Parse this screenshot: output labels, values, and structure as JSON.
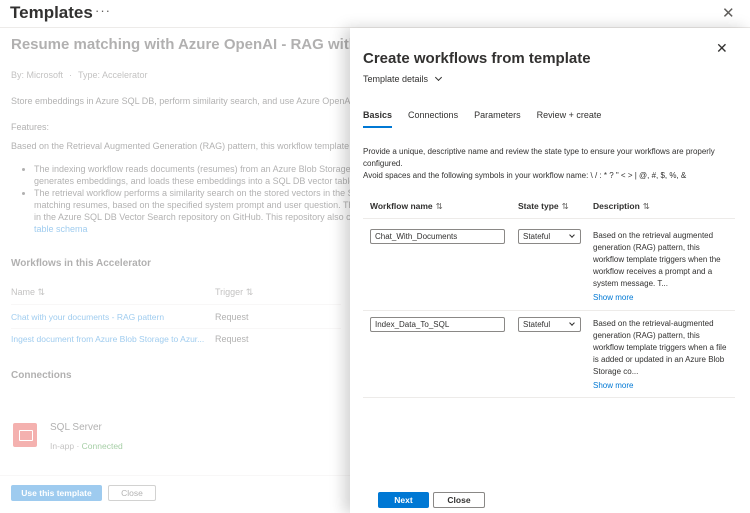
{
  "page": {
    "title": "Templates",
    "more_icon": "ellipsis-icon",
    "close_icon": "close-icon"
  },
  "background": {
    "template_title": "Resume matching with Azure OpenAI - RAG with",
    "publisher": "By: Microsoft",
    "type": "Type: Accelerator",
    "description": "Store embeddings in Azure SQL DB, perform similarity search, and use Azure OpenAI LL",
    "features_label": "Features:",
    "features_intro": "Based on the Retrieval Augmented Generation (RAG) pattern, this workflow template is",
    "bullets": [
      "The indexing workflow reads documents (resumes) from an Azure Blob Storage c",
      "generates embeddings, and loads these embeddings into a SQL DB vector table",
      "The retrieval workflow performs a similarity search on the stored vectors in the S",
      "matching resumes, based on the specified system prompt and user question. Th",
      "in the Azure SQL DB Vector Search repository on GitHub. This repository also co"
    ],
    "bullet_link": "table schema",
    "workflows_heading": "Workflows in this Accelerator",
    "table_headers": {
      "name": "Name",
      "trigger": "Trigger"
    },
    "workflows": [
      {
        "name": "Chat with your documents - RAG pattern",
        "trigger": "Request"
      },
      {
        "name": "Ingest document from Azure Blob Storage to Azur...",
        "trigger": "Request"
      }
    ],
    "connections_heading": "Connections",
    "connection": {
      "name": "SQL Server",
      "kind": "In-app",
      "status": "Connected"
    },
    "use_button": "Use this template",
    "close_button": "Close"
  },
  "panel": {
    "title": "Create workflows from template",
    "details_dropdown": "Template details",
    "tabs": [
      "Basics",
      "Connections",
      "Parameters",
      "Review + create"
    ],
    "active_tab": "Basics",
    "instructions_1": "Provide a unique, descriptive name and review the state type to ensure your workflows are properly configured.",
    "instructions_2": "Avoid spaces and the following symbols in your workflow name: \\ / : * ? \" < > | @, #, $, %, &",
    "columns": {
      "workflow_name": "Workflow name",
      "state_type": "State type",
      "description": "Description",
      "sort_icon": "⇅"
    },
    "rows": [
      {
        "workflow_name": "Chat_With_Documents",
        "state_type": "Stateful",
        "description": "Based on the retrieval augmented generation (RAG) pattern, this workflow template triggers when the workflow receives a prompt and a system message. T...",
        "show_more": "Show more"
      },
      {
        "workflow_name": "Index_Data_To_SQL",
        "state_type": "Stateful",
        "description": "Based on the retrieval-augmented generation (RAG) pattern, this workflow template triggers when a file is added or updated in an Azure Blob Storage co...",
        "show_more": "Show more"
      }
    ],
    "next_button": "Next",
    "close_button": "Close"
  },
  "colors": {
    "accent": "#0078d4",
    "text": "#323130",
    "connected": "#107c10",
    "sql_icon": "#e3342f"
  }
}
